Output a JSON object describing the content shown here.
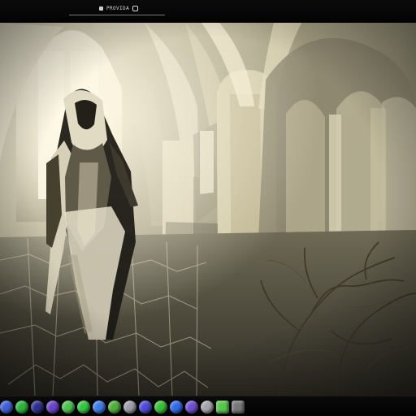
{
  "window": {
    "title": "PROVIDA",
    "title_icon": "square-icon",
    "title_badge_icon": "rounded-square-icon"
  },
  "viewer": {
    "image_description": "",
    "palette": {
      "stone": "#d8d2b6",
      "shadow": "#2b2a20",
      "glow": "#f3efd6",
      "branch": "#4a4330",
      "dark_robe": "#1f1d16"
    }
  },
  "taskbar": {
    "icons": [
      {
        "name": "blue-orb-icon",
        "color": "#4060d8"
      },
      {
        "name": "green-orb-icon",
        "color": "#2fb33d"
      },
      {
        "name": "navy-orb-icon",
        "color": "#2d2f8c"
      },
      {
        "name": "purple-orb-icon",
        "color": "#6a45c8"
      },
      {
        "name": "green-shell-icon",
        "color": "#4bc24f"
      },
      {
        "name": "lime-orb-icon",
        "color": "#33c640"
      },
      {
        "name": "blue-drop-icon",
        "color": "#3f7be6"
      },
      {
        "name": "green-leaf-icon",
        "color": "#4fae3a"
      },
      {
        "name": "gray-orb-icon",
        "color": "#9d9da8"
      },
      {
        "name": "indigo-orb-icon",
        "color": "#4b4ad8"
      },
      {
        "name": "green-star-icon",
        "color": "#3abf35"
      },
      {
        "name": "blue-diamond-icon",
        "color": "#2f6be8"
      },
      {
        "name": "purple-gem-icon",
        "color": "#6f4ed2"
      },
      {
        "name": "gray-sphere-icon",
        "color": "#a4a4aa"
      },
      {
        "name": "lime-square-icon",
        "color": "#58c64c"
      },
      {
        "name": "dark-gray-icon",
        "color": "#777777"
      }
    ]
  }
}
